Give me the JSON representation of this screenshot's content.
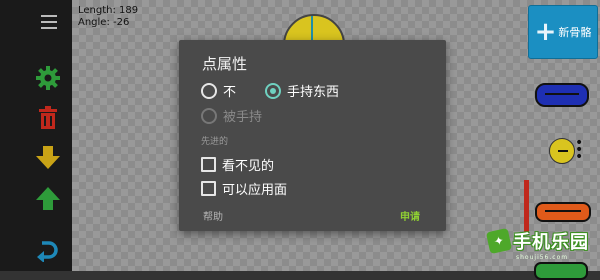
{
  "canvas_info": {
    "length": "Length: 189",
    "angle": "Angle: -26"
  },
  "toolbar": {
    "items": [
      "menu-icon",
      "gear-icon",
      "trash-icon",
      "arrow-down-icon",
      "arrow-up-icon",
      "undo-icon"
    ]
  },
  "new_bone": {
    "icon": "plus",
    "label": "新骨骼"
  },
  "dialog": {
    "title": "点属性",
    "options": {
      "none": "不",
      "holding": "手持东西",
      "held": "被手持",
      "selected": "holding"
    },
    "advanced_label": "先进的",
    "checkboxes": {
      "invisible": "看不见的",
      "face_applicable": "可以应用面"
    },
    "help_button": "帮助",
    "apply_button": "申请"
  },
  "watermark": {
    "text": "手机乐园",
    "sub": "shouji56.com"
  },
  "colors": {
    "accent_radio": "#6fd1c0",
    "apply_green": "#8fcf33",
    "new_bone_blue": "#1b8fc2",
    "toolbar_green": "#2e9b3a",
    "toolbar_red": "#c0281c",
    "toolbar_yellow": "#c9a316",
    "toolbar_blue": "#1e88b8"
  }
}
